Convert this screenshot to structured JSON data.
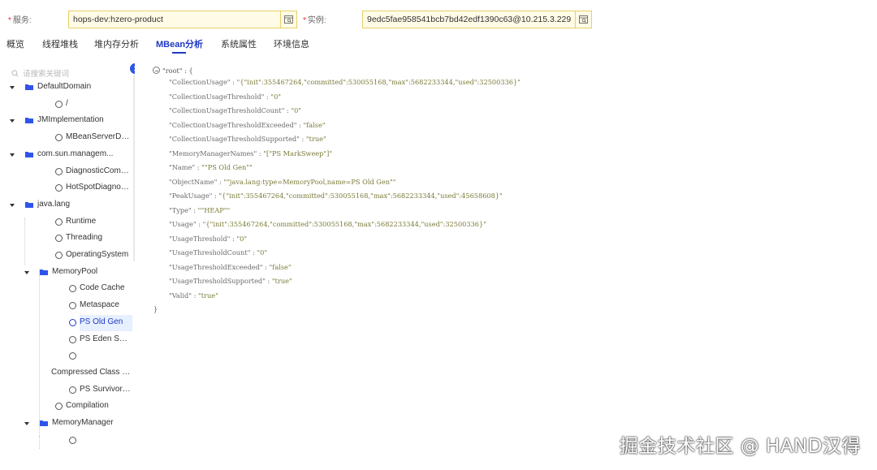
{
  "form": {
    "service_label": "服务:",
    "service_value": "hops-dev:hzero-product",
    "instance_label": "实例:",
    "instance_value": "9edc5fae958541bcb7bd42edf1390c63@10.215.3.229",
    "required_mark": "*"
  },
  "tabs": [
    {
      "label": "概览"
    },
    {
      "label": "线程堆栈"
    },
    {
      "label": "堆内存分析"
    },
    {
      "label": "MBean分析"
    },
    {
      "label": "系统属性"
    },
    {
      "label": "环境信息"
    }
  ],
  "sidebar": {
    "search_placeholder": "请搜索关键词",
    "items": [
      {
        "label": "DefaultDomain"
      },
      {
        "label": "/"
      },
      {
        "label": "JMImplementation"
      },
      {
        "label": "MBeanServerDeleg..."
      },
      {
        "label": "com.sun.managem..."
      },
      {
        "label": "DiagnosticCommand"
      },
      {
        "label": "HotSpotDiagnostic"
      },
      {
        "label": "java.lang"
      },
      {
        "label": "Runtime"
      },
      {
        "label": "Threading"
      },
      {
        "label": "OperatingSystem"
      },
      {
        "label": "MemoryPool"
      },
      {
        "label": "Code Cache"
      },
      {
        "label": "Metaspace"
      },
      {
        "label": "PS Old Gen"
      },
      {
        "label": "PS Eden Space"
      },
      {
        "label": ""
      },
      {
        "label": "Compressed Class S..."
      },
      {
        "label": "PS Survivor Space"
      },
      {
        "label": "Compilation"
      },
      {
        "label": "MemoryManager"
      },
      {
        "label": ""
      }
    ]
  },
  "json_view": {
    "root_open": "\"root\" : {",
    "root_close": "}",
    "lines": [
      {
        "key": "\"CollectionUsage\" : ",
        "value": "\"{\"init\":355467264,\"committed\":530055168,\"max\":5682233344,\"used\":32500336}\""
      },
      {
        "key": "\"CollectionUsageThreshold\" : ",
        "value": "\"0\""
      },
      {
        "key": "\"CollectionUsageThresholdCount\" : ",
        "value": "\"0\""
      },
      {
        "key": "\"CollectionUsageThresholdExceeded\" : ",
        "value": "\"false\""
      },
      {
        "key": "\"CollectionUsageThresholdSupported\" : ",
        "value": "\"true\""
      },
      {
        "key": "\"MemoryManagerNames\" : ",
        "value": "\"[\"PS MarkSweep\"]\""
      },
      {
        "key": "\"Name\" : ",
        "value": "\"\"PS Old Gen\"\""
      },
      {
        "key": "\"ObjectName\" : ",
        "value": "\"\"java.lang:type=MemoryPool,name=PS Old Gen\"\""
      },
      {
        "key": "\"PeakUsage\" : ",
        "value": "\"{\"init\":355467264,\"committed\":530055168,\"max\":5682233344,\"used\":45658608}\""
      },
      {
        "key": "\"Type\" : ",
        "value": "\"\"HEAP\"\""
      },
      {
        "key": "\"Usage\" : ",
        "value": "\"{\"init\":355467264,\"committed\":530055168,\"max\":5682233344,\"used\":32500336}\""
      },
      {
        "key": "\"UsageThreshold\" : ",
        "value": "\"0\""
      },
      {
        "key": "\"UsageThresholdCount\" : ",
        "value": "\"0\""
      },
      {
        "key": "\"UsageThresholdExceeded\" : ",
        "value": "\"false\""
      },
      {
        "key": "\"UsageThresholdSupported\" : ",
        "value": "\"true\""
      },
      {
        "key": "\"Valid\" : ",
        "value": "\"true\""
      }
    ]
  },
  "watermark": "掘金技术社区 @ HAND汉得",
  "colors": {
    "accent": "#1d39c4",
    "input_bg": "#fffbe6",
    "input_border": "#e6d06a"
  }
}
